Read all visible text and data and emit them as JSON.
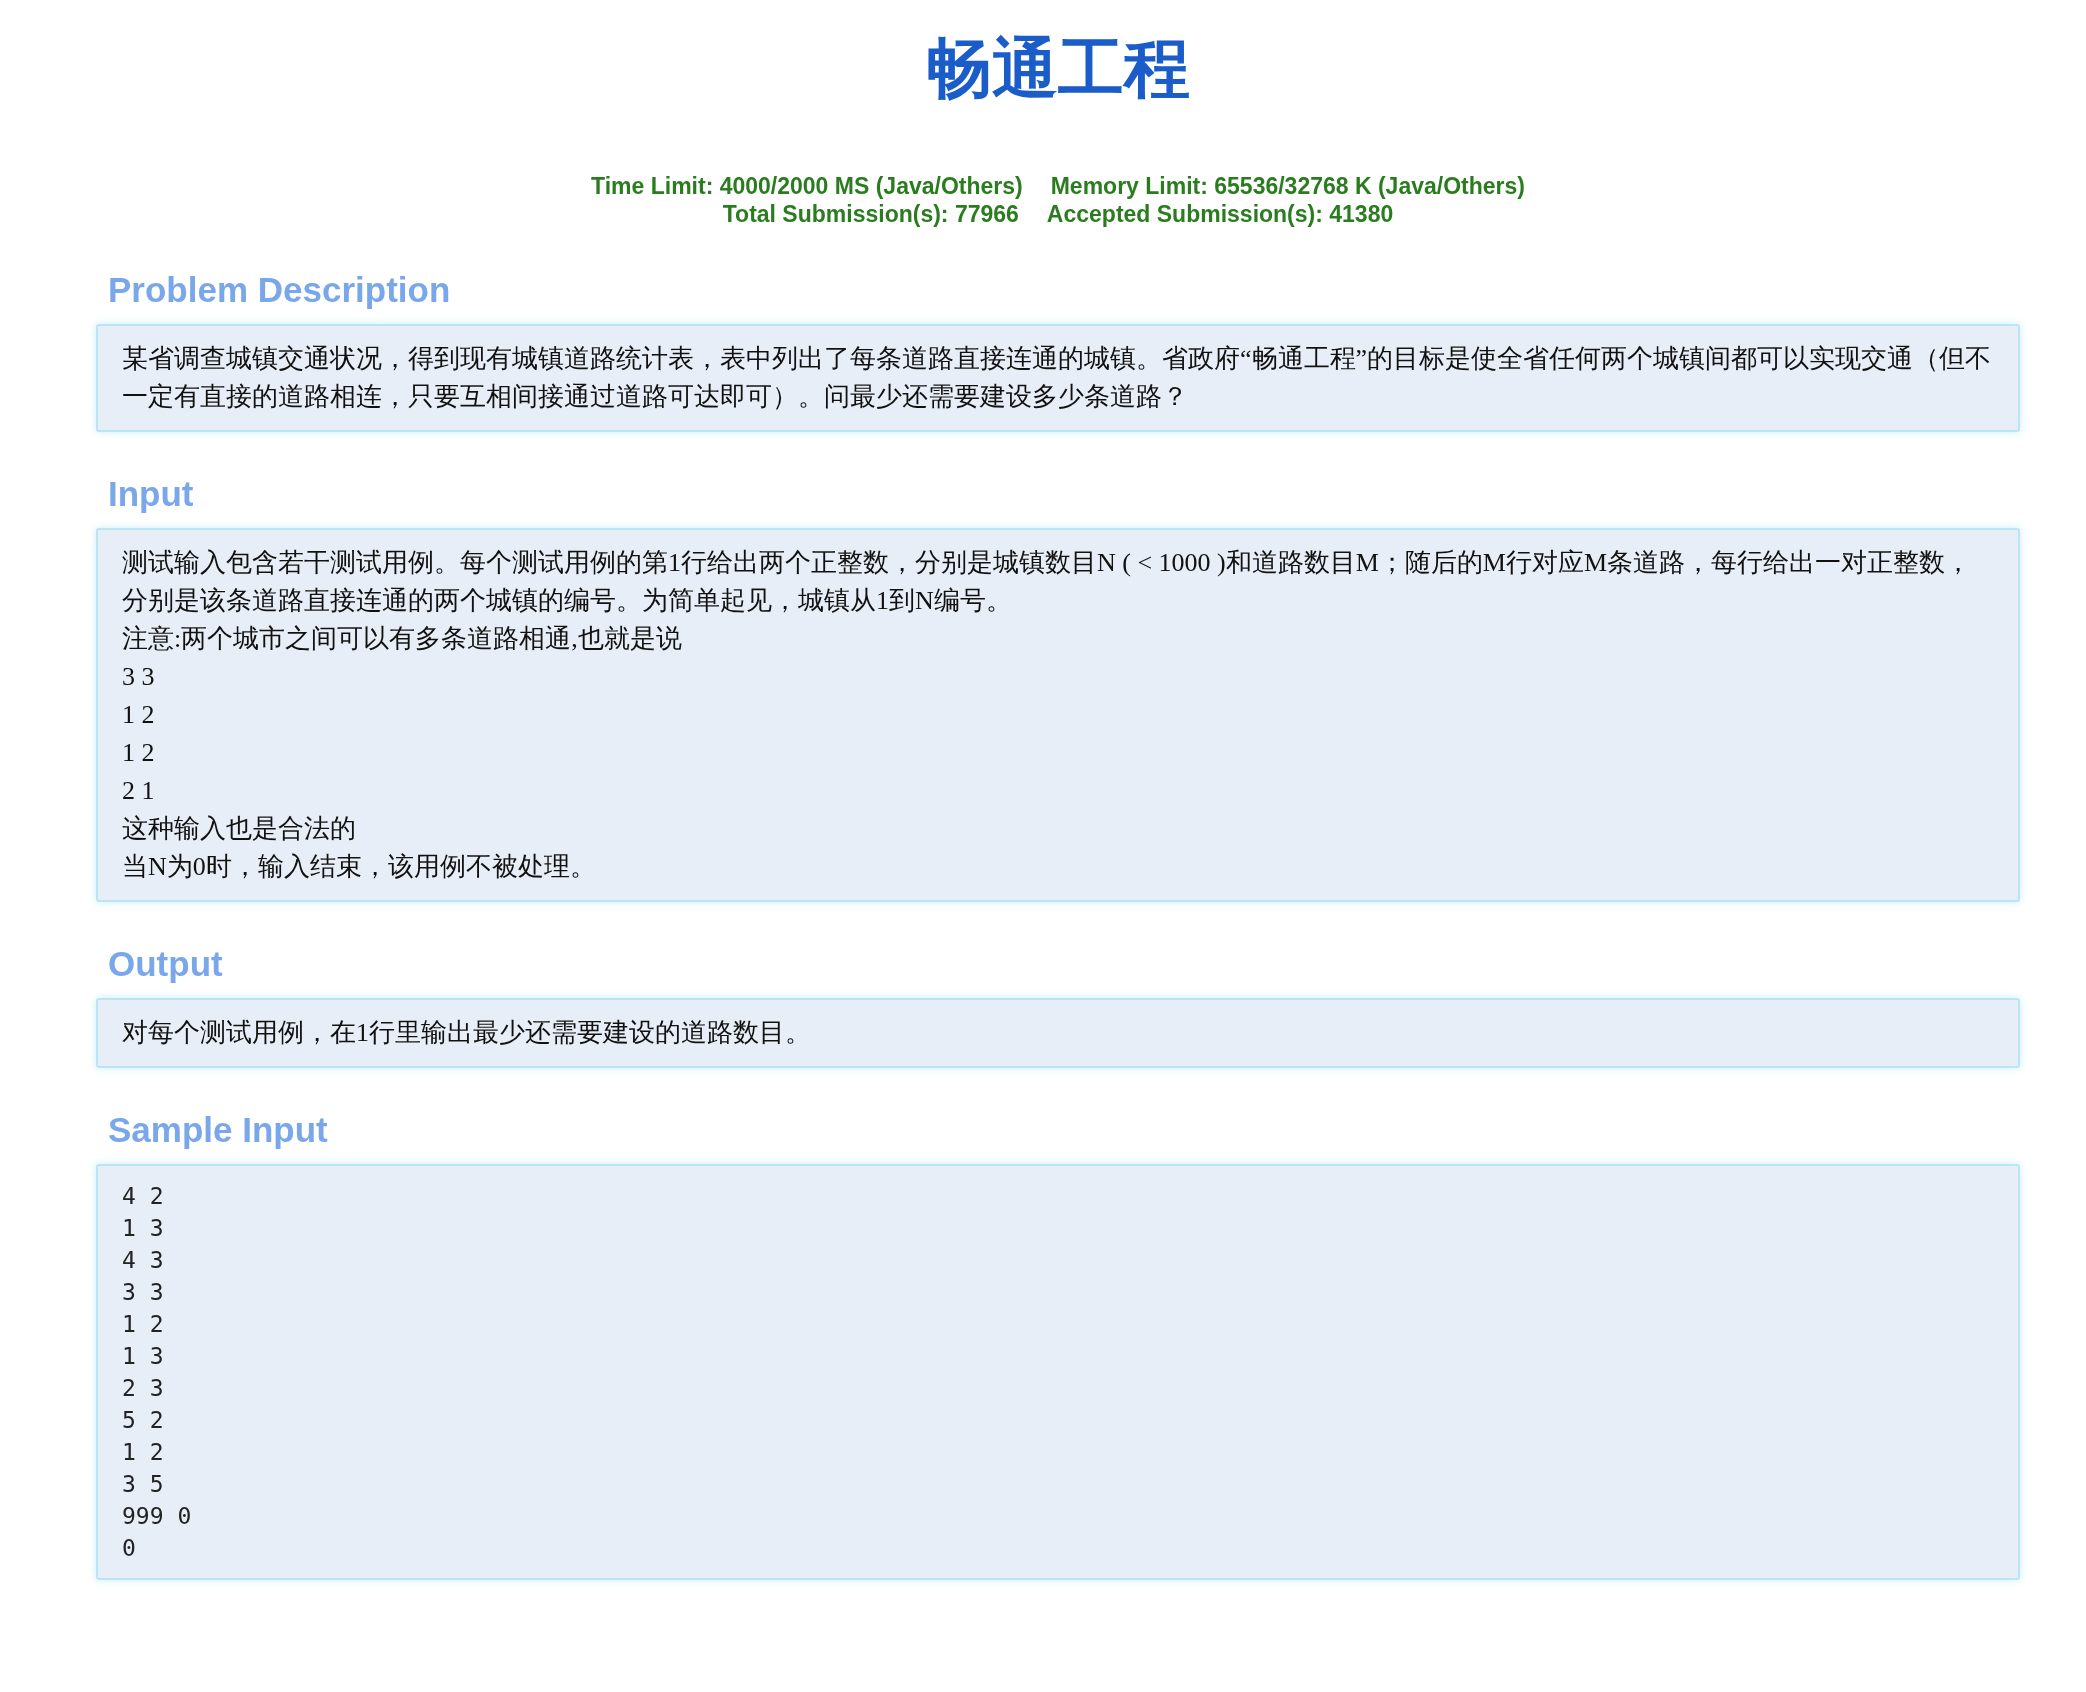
{
  "title": "畅通工程",
  "info": [
    [
      "Time Limit: 4000/2000 MS (Java/Others)",
      "Memory Limit: 65536/32768 K (Java/Others)"
    ],
    [
      "Total Submission(s): 77966",
      "Accepted Submission(s): 41380"
    ]
  ],
  "sections": [
    {
      "heading": "Problem Description",
      "kind": "text",
      "lines": [
        "某省调查城镇交通状况，得到现有城镇道路统计表，表中列出了每条道路直接连通的城镇。省政府“畅通工程”的目标是使全省任何两个城镇间都可以实现交通（但不一定有直接的道路相连，只要互相间接通过道路可达即可）。问最少还需要建设多少条道路？"
      ]
    },
    {
      "heading": "Input",
      "kind": "text",
      "lines": [
        "测试输入包含若干测试用例。每个测试用例的第1行给出两个正整数，分别是城镇数目N ( < 1000 )和道路数目M；随后的M行对应M条道路，每行给出一对正整数，分别是该条道路直接连通的两个城镇的编号。为简单起见，城镇从1到N编号。",
        "注意:两个城市之间可以有多条道路相通,也就是说",
        "3 3",
        "1 2",
        "1 2",
        "2 1",
        "这种输入也是合法的",
        "当N为0时，输入结束，该用例不被处理。"
      ]
    },
    {
      "heading": "Output",
      "kind": "text",
      "lines": [
        "对每个测试用例，在1行里输出最少还需要建设的道路数目。"
      ]
    },
    {
      "heading": "Sample Input",
      "kind": "code",
      "lines": [
        "4 2",
        "1 3",
        "4 3",
        "3 3",
        "1 2",
        "1 3",
        "2 3",
        "5 2",
        "1 2",
        "3 5",
        "999 0",
        "0"
      ]
    }
  ]
}
